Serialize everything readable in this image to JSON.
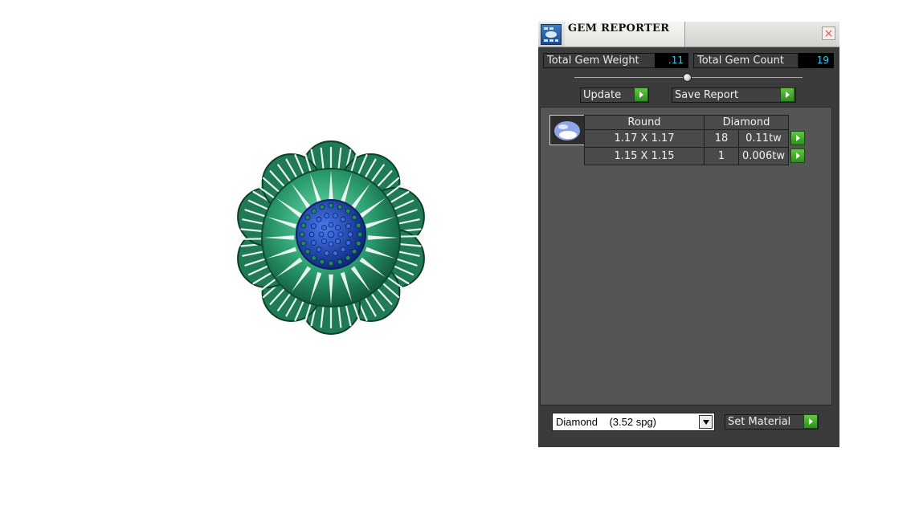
{
  "panel": {
    "title": "GEM REPORTER",
    "close_icon": "close-icon",
    "total_weight_label": "Total Gem Weight",
    "total_weight_value": ".11",
    "total_count_label": "Total Gem Count",
    "total_count_value": "19",
    "update_label": "Update",
    "save_label": "Save Report",
    "gem_thumbnail_icon": "round-gem-icon",
    "table": {
      "headers": [
        "Round",
        "Diamond"
      ],
      "rows": [
        {
          "size": "1.17 X 1.17",
          "count": "18",
          "weight": "0.11tw"
        },
        {
          "size": "1.15 X 1.15",
          "count": "1",
          "weight": "0.006tw"
        }
      ]
    },
    "material_selected": "Diamond    (3.52 spg)",
    "set_material_label": "Set Material"
  },
  "colors": {
    "panel_bg": "#3b3b3b",
    "value_text": "#2ad1ff",
    "go_button": "#3aa424",
    "metal": "#2a9a6c",
    "gems": "#1b3fa6"
  }
}
